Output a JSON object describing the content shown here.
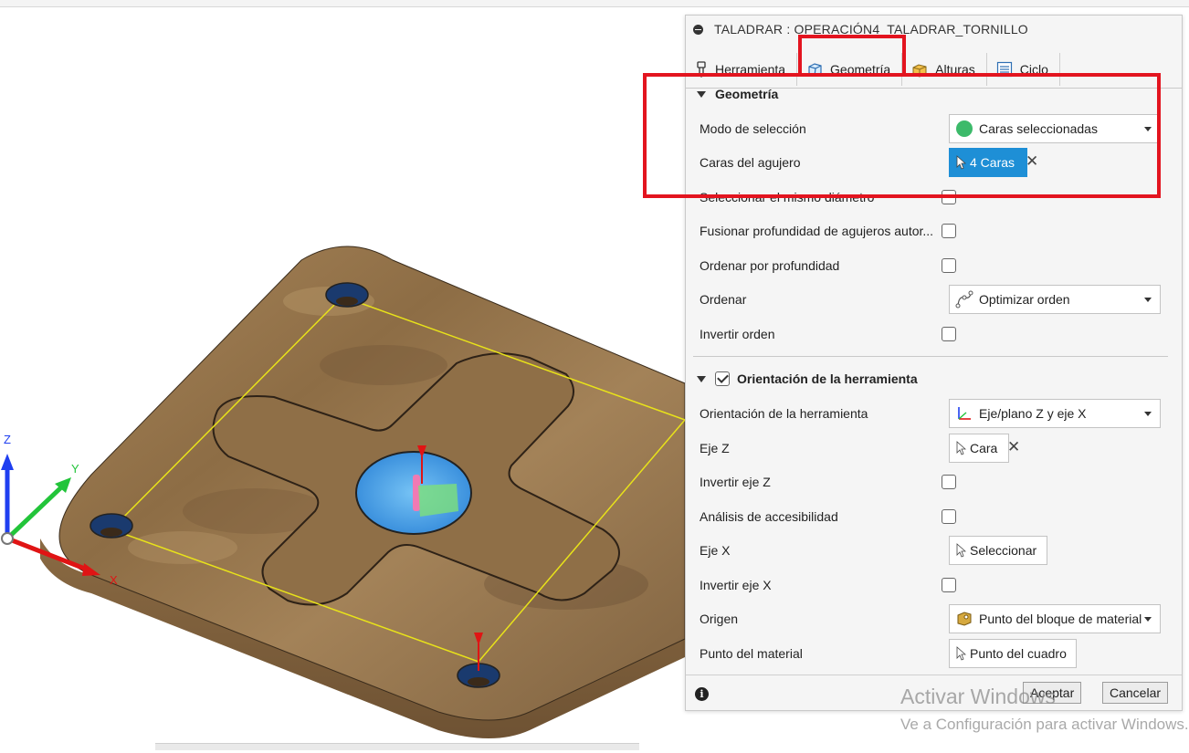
{
  "panel": {
    "title": "TALADRAR : OPERACIÓN4_TALADRAR_TORNILLO",
    "tabs": [
      {
        "label": "Herramienta",
        "icon": "drill-tool-icon"
      },
      {
        "label": "Geometría",
        "icon": "geometry-cube-icon",
        "active": true
      },
      {
        "label": "Alturas",
        "icon": "heights-box-icon"
      },
      {
        "label": "Ciclo",
        "icon": "cycle-list-icon"
      }
    ],
    "geometry_section": {
      "title": "Geometría",
      "modo_label": "Modo de selección",
      "modo_value": "Caras seleccionadas",
      "caras_label": "Caras del agujero",
      "caras_value": "4 Caras",
      "mismo_diametro_label": "Seleccionar el mismo diámetro",
      "fusionar_label": "Fusionar profundidad de agujeros autor...",
      "ordenar_prof_label": "Ordenar por profundidad",
      "ordenar_label": "Ordenar",
      "ordenar_value": "Optimizar orden",
      "invertir_orden_label": "Invertir orden"
    },
    "orientation_section": {
      "title": "Orientación de la herramienta",
      "checked": true,
      "orient_label": "Orientación de la herramienta",
      "orient_value": "Eje/plano Z y eje X",
      "ejez_label": "Eje Z",
      "ejez_value": "Cara",
      "invertir_z_label": "Invertir eje Z",
      "accesibilidad_label": "Análisis de accesibilidad",
      "ejex_label": "Eje X",
      "ejex_value": "Seleccionar",
      "invertir_x_label": "Invertir eje X",
      "origen_label": "Origen",
      "origen_value": "Punto del bloque de material",
      "punto_label": "Punto del material",
      "punto_value": "Punto del cuadro"
    },
    "footer": {
      "aceptar": "Aceptar",
      "cancelar": "Cancelar"
    }
  },
  "axes": {
    "z": "Z",
    "y": "Y",
    "x": "X"
  },
  "watermark": {
    "line1": "Activar Windows",
    "line2": "Ve a Configuración para activar Windows."
  },
  "colors": {
    "highlight": "#e3141f",
    "selection_blue": "#1e8fd6",
    "wood": "#9a7a50",
    "green_mode": "#3cba6a"
  }
}
